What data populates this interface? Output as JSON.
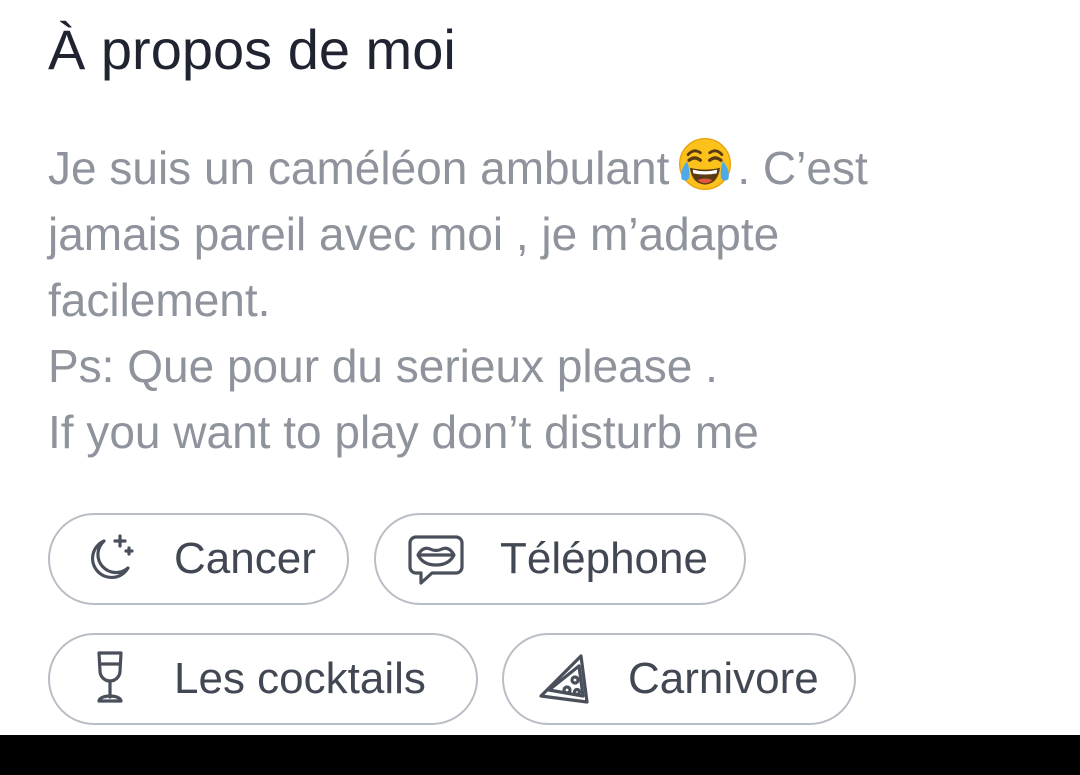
{
  "section": {
    "title": "À propos de moi"
  },
  "bio": {
    "line1_before_emoji": "Je suis un caméléon ambulant",
    "emoji_icon": "face-with-tears-of-joy-icon",
    "line1_after_emoji": ". C’est",
    "line2": "jamais pareil avec moi , je m’adapte",
    "line3": "facilement.",
    "line4": "Ps: Que pour du serieux please .",
    "line5": "If you want to play don’t disturb me"
  },
  "tags": [
    {
      "label": "Cancer",
      "icon": "moon-stars-icon"
    },
    {
      "label": "Téléphone",
      "icon": "speech-bubble-lips-icon"
    },
    {
      "label": "Les cocktails",
      "icon": "wine-glass-icon"
    },
    {
      "label": "Carnivore",
      "icon": "pizza-slice-icon"
    }
  ],
  "colors": {
    "title": "#1f2430",
    "bio_text": "#8e939c",
    "chip_border": "#b9bdc5",
    "chip_text": "#424853",
    "icon_stroke": "#4a505b",
    "background": "#ffffff"
  }
}
